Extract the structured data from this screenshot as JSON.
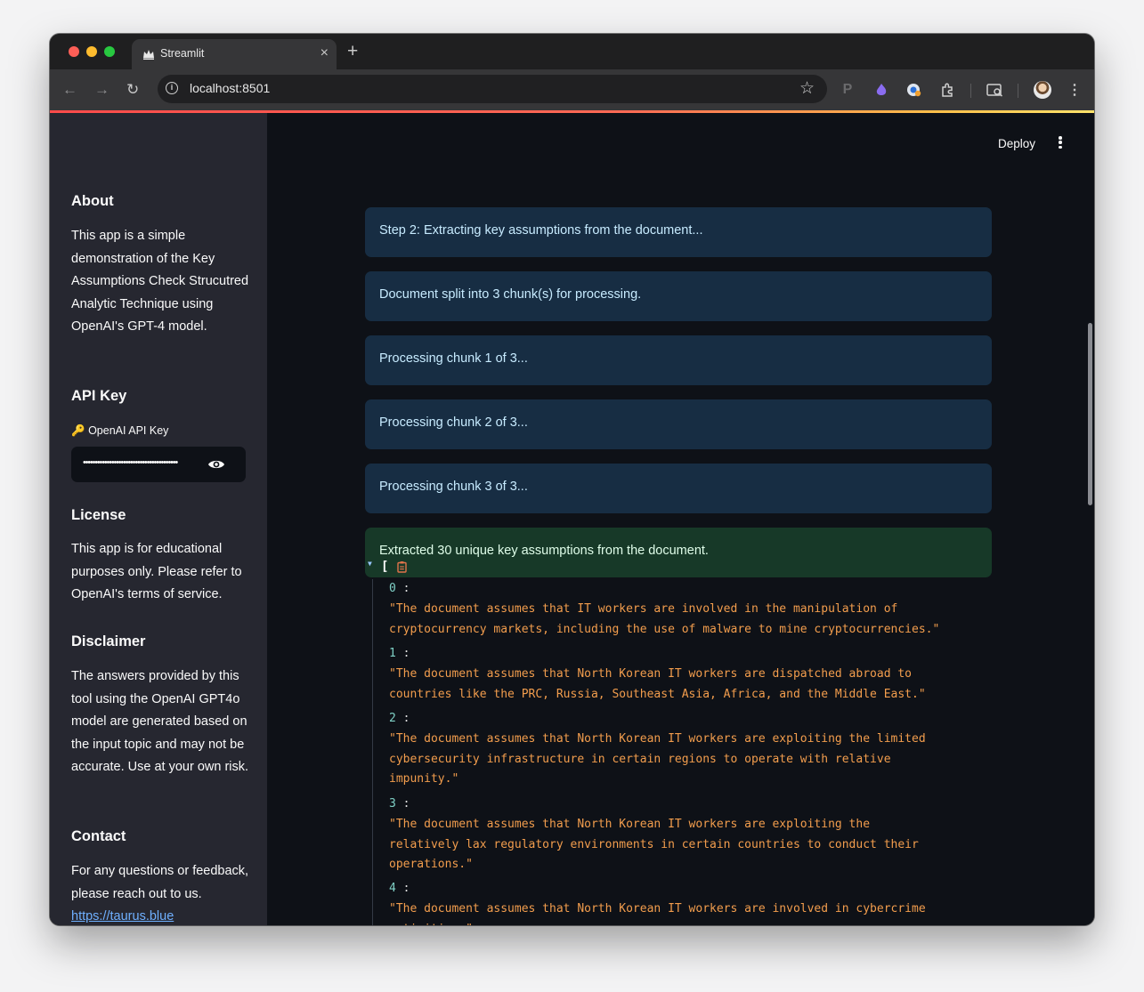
{
  "browser": {
    "tab_title": "Streamlit",
    "url": "localhost:8501"
  },
  "header": {
    "deploy_label": "Deploy"
  },
  "sidebar": {
    "about_title": "About",
    "about_text": "This app is a simple demonstration of the Key Assumptions Check Strucutred Analytic Technique using OpenAI's GPT-4 model.",
    "api_title": "API Key",
    "api_label_icon": "🔑",
    "api_label": "OpenAI API Key",
    "api_value": "••••••••••••••••••••••••••••••••••••••••",
    "license_title": "License",
    "license_text": "This app is for educational purposes only. Please refer to OpenAI's terms of service.",
    "disclaimer_title": "Disclaimer",
    "disclaimer_text": "The answers provided by this tool using the OpenAI GPT4o model are generated based on the input topic and may not be accurate. Use at your own risk.",
    "contact_title": "Contact",
    "contact_text": "For any questions or feedback, please reach out to us.",
    "contact_link": "https://taurus.blue"
  },
  "main": {
    "messages": [
      {
        "type": "info",
        "text": "Step 2: Extracting key assumptions from the document..."
      },
      {
        "type": "info",
        "text": "Document split into 3 chunk(s) for processing."
      },
      {
        "type": "info",
        "text": "Processing chunk 1 of 3..."
      },
      {
        "type": "info",
        "text": "Processing chunk 2 of 3..."
      },
      {
        "type": "info",
        "text": "Processing chunk 3 of 3..."
      },
      {
        "type": "success",
        "text": "Extracted 30 unique key assumptions from the document."
      }
    ],
    "json_open": "[",
    "json_items": [
      {
        "key": "0",
        "value": "\"The document assumes that IT workers are involved in the manipulation of\ncryptocurrency markets, including the use of malware to mine cryptocurrencies.\""
      },
      {
        "key": "1",
        "value": "\"The document assumes that North Korean IT workers are dispatched abroad to\ncountries like the PRC, Russia, Southeast Asia, Africa, and the Middle East.\""
      },
      {
        "key": "2",
        "value": "\"The document assumes that North Korean IT workers are exploiting the limited\ncybersecurity infrastructure in certain regions to operate with relative\nimpunity.\""
      },
      {
        "key": "3",
        "value": "\"The document assumes that North Korean IT workers are exploiting the\nrelatively lax regulatory environments in certain countries to conduct their\noperations.\""
      },
      {
        "key": "4",
        "value": "\"The document assumes that North Korean IT workers are involved in cybercrime\nactivities.\""
      }
    ]
  }
}
